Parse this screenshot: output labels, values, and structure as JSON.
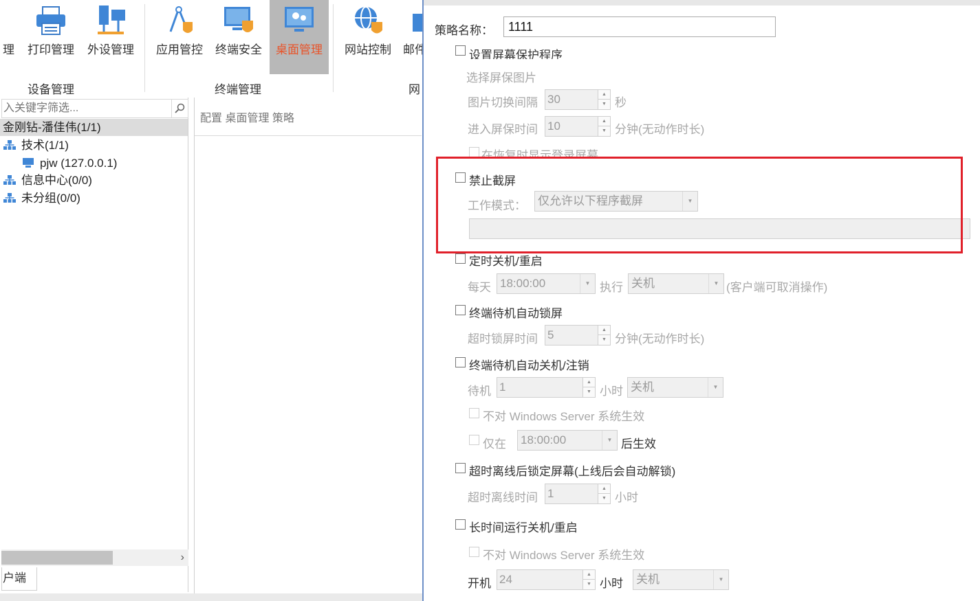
{
  "ribbon": {
    "items": [
      {
        "label": "理",
        "icon": "settings-icon-partial"
      },
      {
        "label": "打印管理",
        "icon": "printer-icon"
      },
      {
        "label": "外设管理",
        "icon": "peripheral-icon"
      },
      {
        "label": "应用管控",
        "icon": "app-control-icon"
      },
      {
        "label": "终端安全",
        "icon": "terminal-security-icon"
      },
      {
        "label": "桌面管理",
        "icon": "desktop-management-icon",
        "active": true
      },
      {
        "label": "网站控制",
        "icon": "globe-icon"
      },
      {
        "label": "邮件",
        "icon": "mail-icon"
      }
    ],
    "groups": [
      "设备管理",
      "终端管理",
      "网"
    ]
  },
  "tree": {
    "search_placeholder": "入关键字筛选...",
    "rows": [
      {
        "label": "金刚钻-潘佳伟(1/1)",
        "icon": "",
        "selected": true
      },
      {
        "label": "技术(1/1)",
        "icon": "group-icon"
      },
      {
        "label": "pjw (127.0.0.1)",
        "icon": "computer-icon"
      },
      {
        "label": "信息中心(0/0)",
        "icon": "group-icon"
      },
      {
        "label": "未分组(0/0)",
        "icon": "group-icon"
      }
    ],
    "bottom_tab": "户端"
  },
  "middle": {
    "header": "配置 桌面管理 策略"
  },
  "dialog": {
    "name_label": "策略名称：",
    "name_value": "1111",
    "screensaver": {
      "label": "设置屏幕保护程序",
      "choose_image": "选择屏保图片",
      "interval_label": "图片切换间隔",
      "interval_value": "30",
      "interval_unit": "秒",
      "enter_label": "进入屏保时间",
      "enter_value": "10",
      "enter_unit": "分钟(无动作时长)",
      "show_login": "在恢复时显示登录屏幕"
    },
    "screenshot": {
      "label": "禁止截屏",
      "mode_label": "工作模式：",
      "mode_value": "仅允许以下程序截屏"
    },
    "scheduled": {
      "label": "定时关机/重启",
      "daily": "每天",
      "time": "18:00:00",
      "exec": "执行",
      "action": "关机",
      "note": "(客户端可取消操作)"
    },
    "idle_lock": {
      "label": "终端待机自动锁屏",
      "timeout_label": "超时锁屏时间",
      "timeout_value": "5",
      "timeout_unit": "分钟(无动作时长)"
    },
    "idle_shutdown": {
      "label": "终端待机自动关机/注销",
      "standby": "待机",
      "standby_value": "1",
      "hours": "小时",
      "action": "关机",
      "no_server": "不对 Windows Server 系统生效",
      "only_at": "仅在",
      "only_time": "18:00:00",
      "after": "后生效"
    },
    "offline_lock": {
      "label": "超时离线后锁定屏幕(上线后会自动解锁)",
      "offline_label": "超时离线时间",
      "offline_value": "1",
      "unit": "小时"
    },
    "long_run": {
      "label": "长时间运行关机/重启",
      "no_server": "不对 Windows Server 系统生效",
      "boot": "开机",
      "boot_value": "24",
      "hours": "小时",
      "action": "关机"
    }
  }
}
